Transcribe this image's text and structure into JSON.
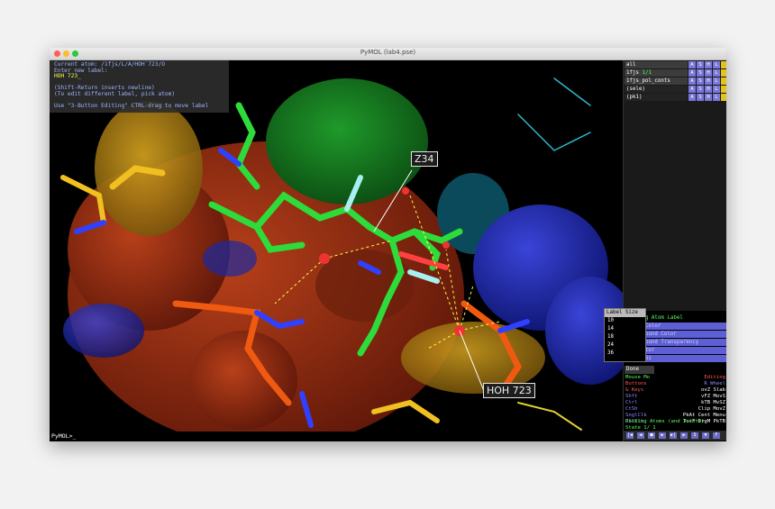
{
  "window": {
    "title": "PyMOL (lab4.pse)"
  },
  "messages": [
    {
      "text": "Current atom: /1fjs/L/A/HOH`723/O",
      "color": "blue"
    },
    {
      "text": "Enter new label:",
      "color": "blue"
    },
    {
      "text": "HOH 723_",
      "color": "yellow"
    },
    {
      "text": "",
      "color": "blue"
    },
    {
      "text": "(Shift-Return inserts newline)",
      "color": "blue"
    },
    {
      "text": "(To edit different label, pick atom)",
      "color": "blue"
    },
    {
      "text": "",
      "color": "blue"
    },
    {
      "text": "Use \"3-Button Editing\" CTRL-drag to move label",
      "color": "blue"
    }
  ],
  "labels": {
    "z34": "Z34",
    "hoh": "HOH 723"
  },
  "command_line": "PyMOL>_",
  "objects": [
    {
      "name": "all",
      "count": ""
    },
    {
      "name": "1fjs",
      "count": "1/1"
    },
    {
      "name": "1fjs_pol_conts",
      "count": ""
    },
    {
      "name": "(sele)",
      "count": ""
    },
    {
      "name": "(pk1)",
      "count": ""
    }
  ],
  "object_buttons": [
    "A",
    "S",
    "H",
    "L",
    ""
  ],
  "wizard": {
    "title": "Editing Atom Label",
    "items": [
      "Label Color",
      "Background Color",
      "Background Transparency",
      "Connector",
      "Label Si"
    ],
    "done": "Done"
  },
  "dropdown": {
    "header": "Label Size",
    "options": [
      "10",
      "14",
      "18",
      "24",
      "36"
    ]
  },
  "mouse_panel": {
    "rows": [
      {
        "text": "Mouse Mo",
        "color": "#5f5"
      },
      {
        "text": "Buttons",
        "color": "#f55"
      },
      {
        "text": "& Keys",
        "color": "#f55"
      },
      {
        "text": "Shft",
        "color": "#88f"
      },
      {
        "text": "Ctrl",
        "color": "#88f"
      },
      {
        "text": "CtSh",
        "color": "#88f"
      },
      {
        "text": "SnglClk",
        "color": "#88f"
      },
      {
        "text": "DblClk",
        "color": "#88f"
      }
    ],
    "right_rows": [
      {
        "text": "Editing",
        "color": "#f55"
      },
      {
        "text": "R  Wheel",
        "color": "#88f"
      },
      {
        "text": "ovZ Slab",
        "color": "#fff"
      },
      {
        "text": "vFZ MovS",
        "color": "#fff"
      },
      {
        "text": "kTB MvSZ",
        "color": "#fff"
      },
      {
        "text": "Clip MovZ",
        "color": "#fff"
      },
      {
        "text": "PkAt Cent Menu",
        "color": "#fff"
      },
      {
        "text": "TorF DrgM PkTB",
        "color": "#fff"
      }
    ],
    "picking": "Picking Atoms (and Joints)",
    "state": "State    1/    1"
  },
  "nav_buttons": [
    "|◀",
    "◀",
    "■",
    "▶",
    "▶|",
    "▶",
    "S",
    "▼",
    "F"
  ]
}
